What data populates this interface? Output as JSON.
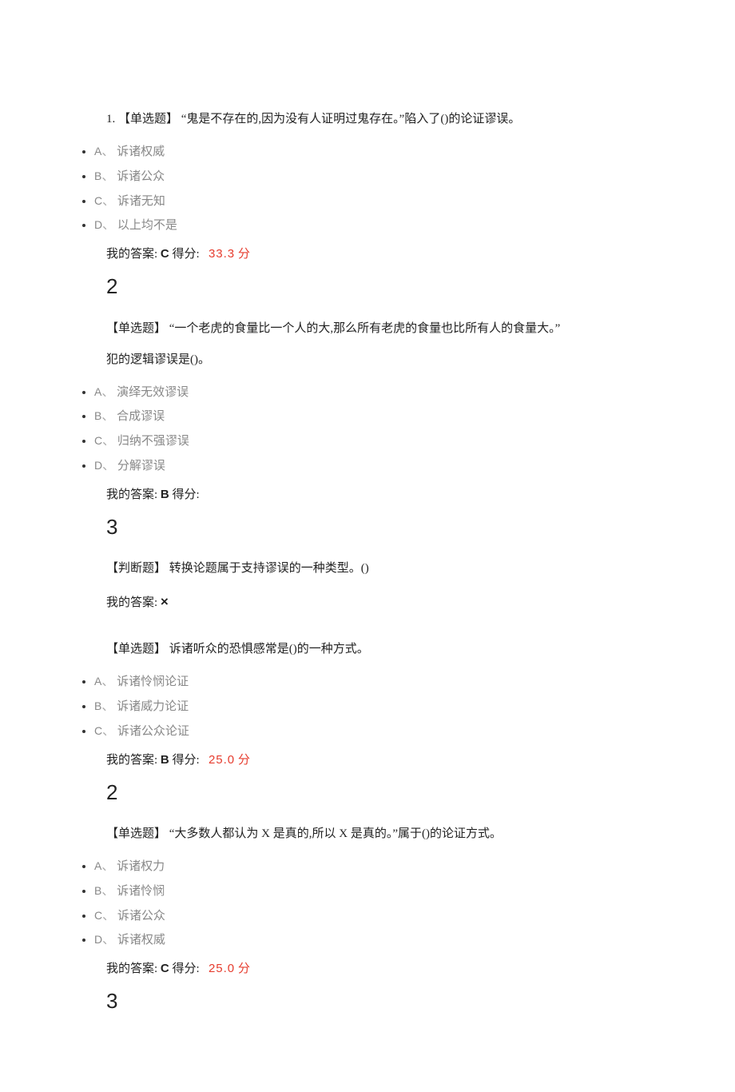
{
  "q1": {
    "prompt_prefix": "1.",
    "type_tag": "【单选题】",
    "text": "“鬼是不存在的,因为没有人证明过鬼存在。”陷入了()的论证谬误。",
    "options": {
      "a_label": "A",
      "a_text": "诉诸权威",
      "b_label": "B",
      "b_text": "诉诸公众",
      "c_label": "C",
      "c_text": "诉诸无知",
      "d_label": "D",
      "d_text": "以上均不是"
    },
    "answer_label": "我的答案:",
    "answer_letter": "C",
    "score_label": "得分:",
    "score_value": "33.3",
    "score_unit": "分",
    "next_number": "2"
  },
  "q2": {
    "type_tag": "【单选题】",
    "text_line1": "“一个老虎的食量比一个人的大,那么所有老虎的食量也比所有人的食量大。”",
    "text_line2": "犯的逻辑谬误是()。",
    "options": {
      "a_label": "A",
      "a_text": "演绎无效谬误",
      "b_label": "B",
      "b_text": "合成谬误",
      "c_label": "C",
      "c_text": "归纳不强谬误",
      "d_label": "D",
      "d_text": "分解谬误"
    },
    "answer_label": "我的答案:",
    "answer_letter": "B",
    "score_label": "得分:",
    "next_number": "3"
  },
  "q3": {
    "type_tag": "【判断题】",
    "text": "转换论题属于支持谬误的一种类型。()",
    "answer_label": "我的答案:",
    "answer_mark": "×"
  },
  "q4": {
    "type_tag": "【单选题】",
    "text": "诉诸听众的恐惧感常是()的一种方式。",
    "options": {
      "a_label": "A",
      "a_text": "诉诸怜悯论证",
      "b_label": "B",
      "b_text": "诉诸威力论证",
      "c_label": "C",
      "c_text": "诉诸公众论证"
    },
    "answer_label": "我的答案:",
    "answer_letter": "B",
    "score_label": "得分:",
    "score_value": "25.0",
    "score_unit": "分",
    "next_number": "2"
  },
  "q5": {
    "type_tag": "【单选题】",
    "text": "“大多数人都认为 X 是真的,所以 X 是真的。”属于()的论证方式。",
    "options": {
      "a_label": "A",
      "a_text": "诉诸权力",
      "b_label": "B",
      "b_text": "诉诸怜悯",
      "c_label": "C",
      "c_text": "诉诸公众",
      "d_label": "D",
      "d_text": "诉诸权威"
    },
    "answer_label": "我的答案:",
    "answer_letter": "C",
    "score_label": "得分:",
    "score_value": "25.0",
    "score_unit": "分",
    "next_number": "3"
  },
  "sep": "、"
}
